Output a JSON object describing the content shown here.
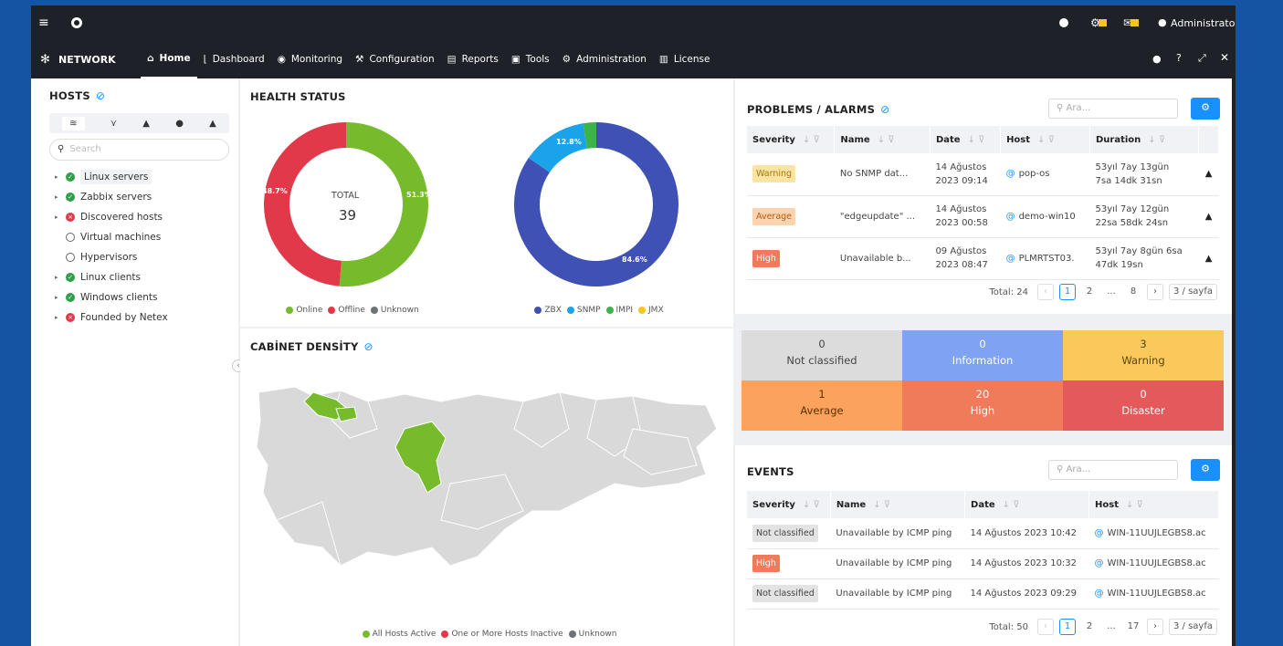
{
  "topbar": {
    "menu_icon": "hamburger-icon",
    "eye_icon": "eye-icon",
    "globe_icon": "globe-icon",
    "user": "Administrator"
  },
  "nav": {
    "brand": "NETWORK",
    "items": [
      "Home",
      "Dashboard",
      "Monitoring",
      "Configuration",
      "Reports",
      "Tools",
      "Administration",
      "License"
    ],
    "active": "Home"
  },
  "hosts": {
    "title": "HOSTS",
    "search_placeholder": "Search",
    "items": [
      {
        "label": "Linux servers",
        "status": "green",
        "expand": true
      },
      {
        "label": "Zabbix servers",
        "status": "green",
        "expand": true
      },
      {
        "label": "Discovered hosts",
        "status": "red",
        "expand": true
      },
      {
        "label": "Virtual machines",
        "status": "empty",
        "expand": false
      },
      {
        "label": "Hypervisors",
        "status": "empty",
        "expand": false
      },
      {
        "label": "Linux clients",
        "status": "green",
        "expand": true
      },
      {
        "label": "Windows clients",
        "status": "green",
        "expand": true
      },
      {
        "label": "Founded by Netex",
        "status": "red",
        "expand": true
      }
    ]
  },
  "health": {
    "title": "HEALTH STATUS",
    "total_label": "TOTAL",
    "total_value": "39",
    "donut1": {
      "online_pct": 51.3,
      "offline_pct": 48.7,
      "online_label": "51.3%",
      "offline_label": "48.7%"
    },
    "donut2": {
      "zbx_pct": 84.6,
      "snmp_pct": 12.8,
      "ipmi_pct": 2.6,
      "zbx_label": "84.6%",
      "snmp_label": "12.8%"
    },
    "legend1": [
      "Online",
      "Offline",
      "Unknown"
    ],
    "legend2": [
      "ZBX",
      "SNMP",
      "IMPI",
      "JMX"
    ]
  },
  "cabinet": {
    "title": "CABİNET DENSİTY",
    "legend": [
      "All Hosts Active",
      "One or More Hosts Inactive",
      "Unknown"
    ]
  },
  "problems": {
    "title": "PROBLEMS / ALARMS",
    "search_placeholder": "Ara...",
    "columns": [
      "Severity",
      "Name",
      "Date",
      "Host",
      "Duration"
    ],
    "rows": [
      {
        "severity": "Warning",
        "name": "No SNMP dat...",
        "date1": "14 Ağustos",
        "date2": "2023 09:14",
        "host": "pop-os",
        "dur1": "53yıl 7ay 13gün",
        "dur2": "7sa 14dk 31sn"
      },
      {
        "severity": "Average",
        "name": "\"edgeupdate\" ...",
        "date1": "14 Ağustos",
        "date2": "2023 00:58",
        "host": "demo-win10",
        "dur1": "53yıl 7ay 12gün",
        "dur2": "22sa 58dk 24sn"
      },
      {
        "severity": "High",
        "name": "Unavailable b...",
        "date1": "09 Ağustos",
        "date2": "2023 08:47",
        "host": "PLMRTST03.",
        "dur1": "53yıl 7ay 8gün 6sa",
        "dur2": "47dk 19sn"
      }
    ],
    "total": "Total: 24",
    "pages": [
      "1",
      "2",
      "...",
      "8"
    ],
    "per_page": "3 / sayfa"
  },
  "severity": [
    {
      "count": "0",
      "label": "Not classified",
      "color": "#dcdcdc",
      "text": "#444"
    },
    {
      "count": "0",
      "label": "Information",
      "color": "#7fa3f2",
      "text": "#fff"
    },
    {
      "count": "3",
      "label": "Warning",
      "color": "#fbc95b",
      "text": "#5a4500"
    },
    {
      "count": "1",
      "label": "Average",
      "color": "#fba35d",
      "text": "#5a3000"
    },
    {
      "count": "20",
      "label": "High",
      "color": "#ef7b5a",
      "text": "#fff"
    },
    {
      "count": "0",
      "label": "Disaster",
      "color": "#e45a5a",
      "text": "#fff"
    }
  ],
  "events": {
    "title": "EVENTS",
    "search_placeholder": "Ara...",
    "columns": [
      "Severity",
      "Name",
      "Date",
      "Host"
    ],
    "rows": [
      {
        "severity": "Not classified",
        "name": "Unavailable by ICMP ping",
        "date": "14 Ağustos 2023 10:42",
        "host": "WIN-11UUJLEGBS8.ac"
      },
      {
        "severity": "High",
        "name": "Unavailable by ICMP ping",
        "date": "14 Ağustos 2023 10:32",
        "host": "WIN-11UUJLEGBS8.ac"
      },
      {
        "severity": "Not classified",
        "name": "Unavailable by ICMP ping",
        "date": "14 Ağustos 2023 09:29",
        "host": "WIN-11UUJLEGBS8.ac"
      }
    ],
    "total": "Total: 50",
    "pages": [
      "1",
      "2",
      "...",
      "17"
    ],
    "per_page": "3 / sayfa"
  },
  "colors": {
    "online": "#76bb2c",
    "offline": "#e2394a",
    "unknown": "#6d7178",
    "zbx": "#3f51b5",
    "snmp": "#1aa3e8",
    "ipmi": "#3db44a",
    "jmx": "#f6c520"
  }
}
